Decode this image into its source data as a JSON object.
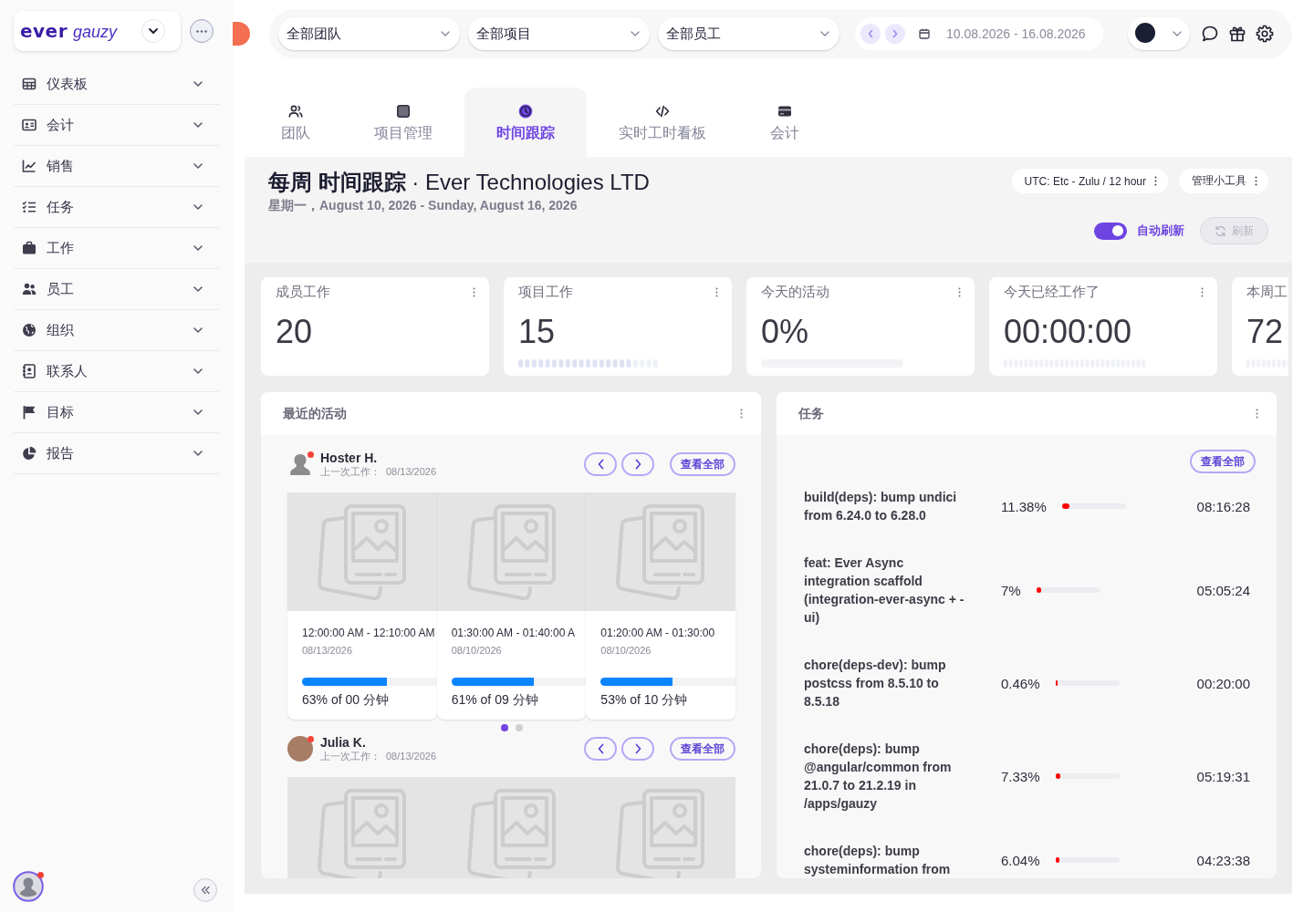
{
  "sidebar": {
    "logo": {
      "word": "ever",
      "suffix": "gauzy"
    },
    "items": [
      {
        "label": "仪表板",
        "expanded": false
      },
      {
        "label": "会计",
        "expanded": false
      },
      {
        "label": "销售",
        "expanded": false
      },
      {
        "label": "任务",
        "expanded": false
      },
      {
        "label": "工作",
        "expanded": false
      },
      {
        "label": "员工",
        "expanded": false
      },
      {
        "label": "组织",
        "expanded": false
      },
      {
        "label": "联系人",
        "expanded": false
      },
      {
        "label": "目标",
        "expanded": false
      },
      {
        "label": "报告",
        "expanded": false
      }
    ],
    "profile": {
      "color": "#f44336"
    }
  },
  "top_bar": {
    "filters": [
      {
        "value": "全部团队"
      },
      {
        "value": "全部项目"
      },
      {
        "value": "全部员工"
      }
    ],
    "date_range": "10.08.2026 - 16.08.2026"
  },
  "tabs": [
    {
      "label": "团队",
      "selected": false
    },
    {
      "label": "项目管理",
      "selected": false
    },
    {
      "label": "时间跟踪",
      "selected": true
    },
    {
      "label": "实时工时看板",
      "selected": false
    },
    {
      "label": "会计",
      "selected": false
    }
  ],
  "header": {
    "title": "**每周 时间跟踪** · Ever Technologies LTD",
    "subtitle": "星期一，August 10, 2026 - Sunday, August 16, 2026",
    "timezone_button": "UTC: Etc - Zulu / 12 hour",
    "widgets_button": "管理小工具",
    "auto_refresh": {
      "label": "自动刷新",
      "on": true
    },
    "refresh_button": {
      "label": "刷新",
      "disabled": true
    }
  },
  "stats": [
    {
      "title": "成员工作",
      "value": "20",
      "kind": "plain"
    },
    {
      "title": "项目工作",
      "value": "15",
      "kind": "bars"
    },
    {
      "title": "今天的活动",
      "value": "0%",
      "kind": "track"
    },
    {
      "title": "今天已经工作了",
      "value": "00:00:00",
      "kind": "faint-bars"
    },
    {
      "title": "本周工",
      "value": "72",
      "kind": "faint-bars"
    }
  ],
  "recent_activity": {
    "title": "最近的活动",
    "users": [
      {
        "name": "Hoster H.",
        "kind": "silhouette",
        "color": "#f44336",
        "last_worked_label": "上一次工作：",
        "last_worked": "08/13/2026",
        "view_all": "查看全部",
        "screenshots": [
          {
            "kind": "card",
            "time": "12:00:00 AM - 12:10:00 AM",
            "date": "08/13/2026",
            "level": 0.63,
            "summary": "63% of 00 分钟"
          },
          {
            "kind": "card",
            "time": "01:30:00 AM - 01:40:00 A",
            "date": "08/10/2026",
            "level": 0.61,
            "summary": "61% of 09 分钟"
          },
          {
            "kind": "card",
            "time": "01:20:00 AM - 01:30:00",
            "date": "08/10/2026",
            "level": 0.53,
            "summary": "53% of 10 分钟"
          }
        ],
        "pager": [
          {
            "selected": true
          },
          {
            "selected": false
          }
        ]
      },
      {
        "name": "Julia K.",
        "kind": "photo",
        "color": "#f44336",
        "last_worked_label": "上一次工作：",
        "last_worked": "08/13/2026",
        "view_all": "查看全部",
        "screenshots": [
          {
            "kind": "image"
          },
          {
            "kind": "image"
          },
          {
            "kind": "image"
          }
        ]
      }
    ]
  },
  "tasks": {
    "title": "任务",
    "view_all": "查看全部",
    "rows": [
      {
        "name": "build(deps): bump undici from 6.24.0 to 6.28.0",
        "percent": "11.38%",
        "level": 0.1138,
        "duration": "08:16:28"
      },
      {
        "name": "feat: Ever Async integration scaffold (integration-ever-async + -ui)",
        "percent": "7%",
        "level": 0.07,
        "duration": "05:05:24"
      },
      {
        "name": "chore(deps-dev): bump postcss from 8.5.10 to 8.5.18",
        "percent": "0.46%",
        "level": 0.0046,
        "duration": "00:20:00"
      },
      {
        "name": "chore(deps): bump @angular/common from 21.0.7 to 21.2.19 in /apps/gauzy",
        "percent": "7.33%",
        "level": 0.0733,
        "duration": "05:19:31"
      },
      {
        "name": "chore(deps): bump systeminformation from",
        "percent": "6.04%",
        "level": 0.0604,
        "duration": "04:23:38"
      }
    ]
  }
}
